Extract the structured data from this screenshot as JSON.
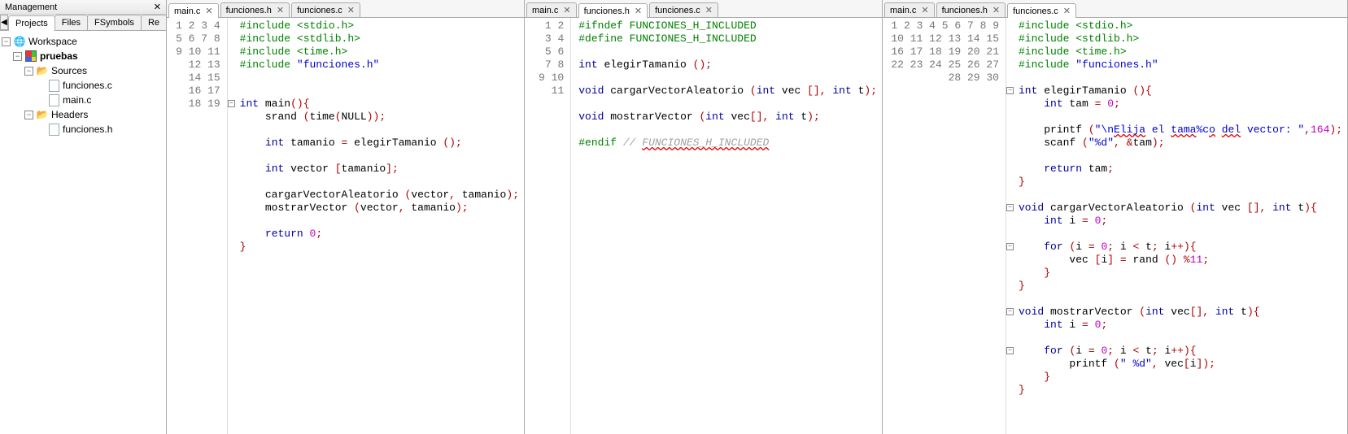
{
  "management": {
    "title": "Management",
    "tabs": [
      "Projects",
      "Files",
      "FSymbols",
      "Re"
    ],
    "active_tab": 0,
    "tree": {
      "root": "Workspace",
      "project": "pruebas",
      "folders": [
        {
          "name": "Sources",
          "files": [
            "funciones.c",
            "main.c"
          ]
        },
        {
          "name": "Headers",
          "files": [
            "funciones.h"
          ]
        }
      ]
    }
  },
  "panes": [
    {
      "tabs": [
        {
          "label": "main.c"
        },
        {
          "label": "funciones.h"
        },
        {
          "label": "funciones.c"
        }
      ],
      "active": 0,
      "lines": 19,
      "code_html": "<span class='pp'>#include</span> <span class='ppfile'>&lt;stdio.h&gt;</span>\n<span class='pp'>#include</span> <span class='ppfile'>&lt;stdlib.h&gt;</span>\n<span class='pp'>#include</span> <span class='ppfile'>&lt;time.h&gt;</span>\n<span class='pp'>#include</span> <span class='str'>\"funciones.h\"</span>\n\n\n<span class='kw'>int</span> main<span class='paren'>(){</span>\n    srand <span class='paren'>(</span>time<span class='paren'>(</span>NULL<span class='paren'>))</span><span class='op'>;</span>\n\n    <span class='kw'>int</span> tamanio <span class='op'>=</span> elegirTamanio <span class='paren'>()</span><span class='op'>;</span>\n\n    <span class='kw'>int</span> vector <span class='paren'>[</span>tamanio<span class='paren'>]</span><span class='op'>;</span>\n\n    cargarVectorAleatorio <span class='paren'>(</span>vector<span class='op'>,</span> tamanio<span class='paren'>)</span><span class='op'>;</span>\n    mostrarVector <span class='paren'>(</span>vector<span class='op'>,</span> tamanio<span class='paren'>)</span><span class='op'>;</span>\n\n    <span class='kw'>return</span> <span class='num'>0</span><span class='op'>;</span>\n<span class='paren'>}</span>\n",
      "folds": {
        "7": "-"
      }
    },
    {
      "tabs": [
        {
          "label": "main.c"
        },
        {
          "label": "funciones.h"
        },
        {
          "label": "funciones.c"
        }
      ],
      "active": 1,
      "lines": 11,
      "code_html": "<span class='pp'>#ifndef FUNCIONES_H_INCLUDED</span>\n<span class='pp'>#define FUNCIONES_H_INCLUDED</span>\n\n<span class='kw'>int</span> elegirTamanio <span class='paren'>()</span><span class='op'>;</span>\n\n<span class='kw'>void</span> cargarVectorAleatorio <span class='paren'>(</span><span class='kw'>int</span> vec <span class='paren'>[]</span><span class='op'>,</span> <span class='kw'>int</span> t<span class='paren'>)</span><span class='op'>;</span>\n\n<span class='kw'>void</span> mostrarVector <span class='paren'>(</span><span class='kw'>int</span> vec<span class='paren'>[]</span><span class='op'>,</span> <span class='kw'>int</span> t<span class='paren'>)</span><span class='op'>;</span>\n\n<span class='pp'>#endif</span> <span class='cmt'>// <span class='wavy'>FUNCIONES_H_INCLUDED</span></span>\n",
      "folds": {}
    },
    {
      "tabs": [
        {
          "label": "main.c"
        },
        {
          "label": "funciones.h"
        },
        {
          "label": "funciones.c"
        }
      ],
      "active": 2,
      "lines": 30,
      "code_html": "<span class='pp'>#include</span> <span class='ppfile'>&lt;stdio.h&gt;</span>\n<span class='pp'>#include</span> <span class='ppfile'>&lt;stdlib.h&gt;</span>\n<span class='pp'>#include</span> <span class='ppfile'>&lt;time.h&gt;</span>\n<span class='pp'>#include</span> <span class='str'>\"funciones.h\"</span>\n\n<span class='kw'>int</span> elegirTamanio <span class='paren'>(){</span>\n    <span class='kw'>int</span> tam <span class='op'>=</span> <span class='num'>0</span><span class='op'>;</span>\n\n    printf <span class='paren'>(</span><span class='str'>\"\\n<span class='wavy'>Elija</span> el <span class='wavy'>tama</span>%c<span class='wavy'>o</span> <span class='wavy'>del</span> vector: \"</span><span class='op'>,</span><span class='num'>164</span><span class='paren'>)</span><span class='op'>;</span>\n    scanf <span class='paren'>(</span><span class='str'>\"%d\"</span><span class='op'>,</span> <span class='op'>&amp;</span>tam<span class='paren'>)</span><span class='op'>;</span>\n\n    <span class='kw'>return</span> tam<span class='op'>;</span>\n<span class='paren'>}</span>\n\n<span class='kw'>void</span> cargarVectorAleatorio <span class='paren'>(</span><span class='kw'>int</span> vec <span class='paren'>[]</span><span class='op'>,</span> <span class='kw'>int</span> t<span class='paren'>){</span>\n    <span class='kw'>int</span> i <span class='op'>=</span> <span class='num'>0</span><span class='op'>;</span>\n\n    <span class='kw'>for</span> <span class='paren'>(</span>i <span class='op'>=</span> <span class='num'>0</span><span class='op'>;</span> i <span class='op'>&lt;</span> t<span class='op'>;</span> i<span class='op'>++</span><span class='paren'>){</span>\n        vec <span class='paren'>[</span>i<span class='paren'>]</span> <span class='op'>=</span> rand <span class='paren'>()</span> <span class='op'>%</span><span class='num'>11</span><span class='op'>;</span>\n    <span class='paren'>}</span>\n<span class='paren'>}</span>\n\n<span class='kw'>void</span> mostrarVector <span class='paren'>(</span><span class='kw'>int</span> vec<span class='paren'>[]</span><span class='op'>,</span> <span class='kw'>int</span> t<span class='paren'>){</span>\n    <span class='kw'>int</span> i <span class='op'>=</span> <span class='num'>0</span><span class='op'>;</span>\n\n    <span class='kw'>for</span> <span class='paren'>(</span>i <span class='op'>=</span> <span class='num'>0</span><span class='op'>;</span> i <span class='op'>&lt;</span> t<span class='op'>;</span> i<span class='op'>++</span><span class='paren'>){</span>\n        printf <span class='paren'>(</span><span class='str'>\" %d\"</span><span class='op'>,</span> vec<span class='paren'>[</span>i<span class='paren'>])</span><span class='op'>;</span>\n    <span class='paren'>}</span>\n<span class='paren'>}</span>\n",
      "folds": {
        "6": "-",
        "15": "-",
        "18": "-",
        "23": "-",
        "26": "-"
      }
    }
  ]
}
